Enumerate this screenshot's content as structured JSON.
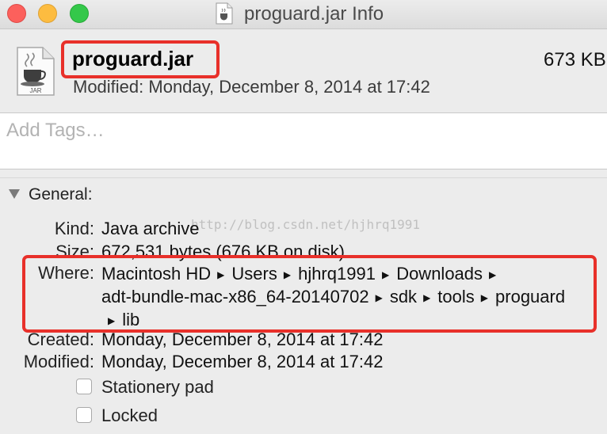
{
  "window": {
    "title": "proguard.jar Info"
  },
  "header": {
    "file_name": "proguard.jar",
    "size_short": "673 KB",
    "modified_line": "Modified: Monday, December 8, 2014 at 17:42",
    "icon_caption": "JAR"
  },
  "tags": {
    "placeholder": "Add Tags…"
  },
  "general": {
    "section_label": "General:",
    "kind_label": "Kind:",
    "kind_value": "Java archive",
    "size_label": "Size:",
    "size_value": "672,531 bytes (676 KB on disk)",
    "where_label": "Where:",
    "where_path": [
      "Macintosh HD",
      "Users",
      "hjhrq1991",
      "Downloads",
      "adt-bundle-mac-x86_64-20140702",
      "sdk",
      "tools",
      "proguard",
      "lib"
    ],
    "created_label": "Created:",
    "created_value": "Monday, December 8, 2014 at 17:42",
    "modified_label": "Modified:",
    "modified_value": "Monday, December 8, 2014 at 17:42",
    "stationery_label": "Stationery pad",
    "stationery_checked": false,
    "locked_label": "Locked",
    "locked_checked": false
  },
  "watermark": "http://blog.csdn.net/hjhrq1991",
  "colors": {
    "annotation": "#e8302a",
    "close": "#fc605c",
    "minimize": "#fdbc40",
    "zoom": "#34c84a"
  },
  "icons": [
    "jar-file-icon",
    "disclosure-triangle-icon",
    "path-arrow-icon"
  ]
}
